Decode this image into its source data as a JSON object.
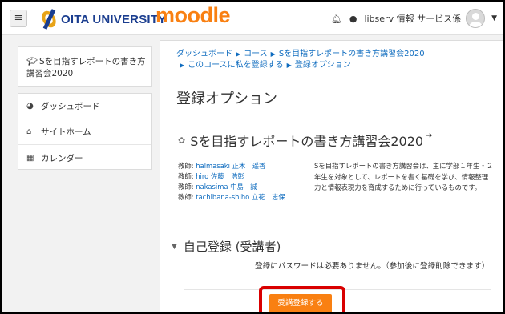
{
  "navbar": {
    "menu_icon": "hamburger-icon",
    "university_name": "OITA UNIVERSITY",
    "logo_small_text": "OITA UNIV.",
    "lms_name": "moodle",
    "icons": [
      "bell-icon",
      "chat-bubble-icon"
    ],
    "user_name": "libserv 情報 サービス係",
    "dropdown_icon": "caret-down-icon"
  },
  "sidebar": {
    "course_link": "Sを目指すレポートの書き方講習会2020",
    "items": [
      {
        "icon": "dashboard-icon",
        "label": "ダッシュボード"
      },
      {
        "icon": "home-icon",
        "label": "サイトホーム"
      },
      {
        "icon": "calendar-icon",
        "label": "カレンダー"
      }
    ]
  },
  "breadcrumb": {
    "items": [
      "ダッシュボード",
      "コース",
      "Sを目指すレポートの書き方講習会2020",
      "このコースに私を登録する",
      "登録オプション"
    ]
  },
  "main": {
    "page_title": "登録オプション",
    "course_title": "Sを目指すレポートの書き方講習会2020",
    "teachers": [
      {
        "label": "教師:",
        "name": "halmasaki 正木　遥香"
      },
      {
        "label": "教師:",
        "name": "hiro 佐藤　浩彰"
      },
      {
        "label": "教師:",
        "name": "nakasima 中島　誠"
      },
      {
        "label": "教師:",
        "name": "tachibana-shiho 立花　志保"
      }
    ],
    "summary": "Sを目指すレポートの書き方講習会は、主に学部１年生・２年生を対象として、レポートを書く基礎を学び、情報整理力と情報表現力を育成するために行っているものです。",
    "enrol_section_title": "自己登録 (受講者)",
    "enrol_note": "登録にパスワードは必要ありません。（参加後に登録削除できます）",
    "enrol_button": "受講登録する"
  },
  "colors": {
    "moodle_orange": "#f98012",
    "link_blue": "#0f6cbf",
    "highlight_red": "#d90000",
    "oita_blue": "#1a3d8f",
    "oita_gold": "#e8a317"
  }
}
